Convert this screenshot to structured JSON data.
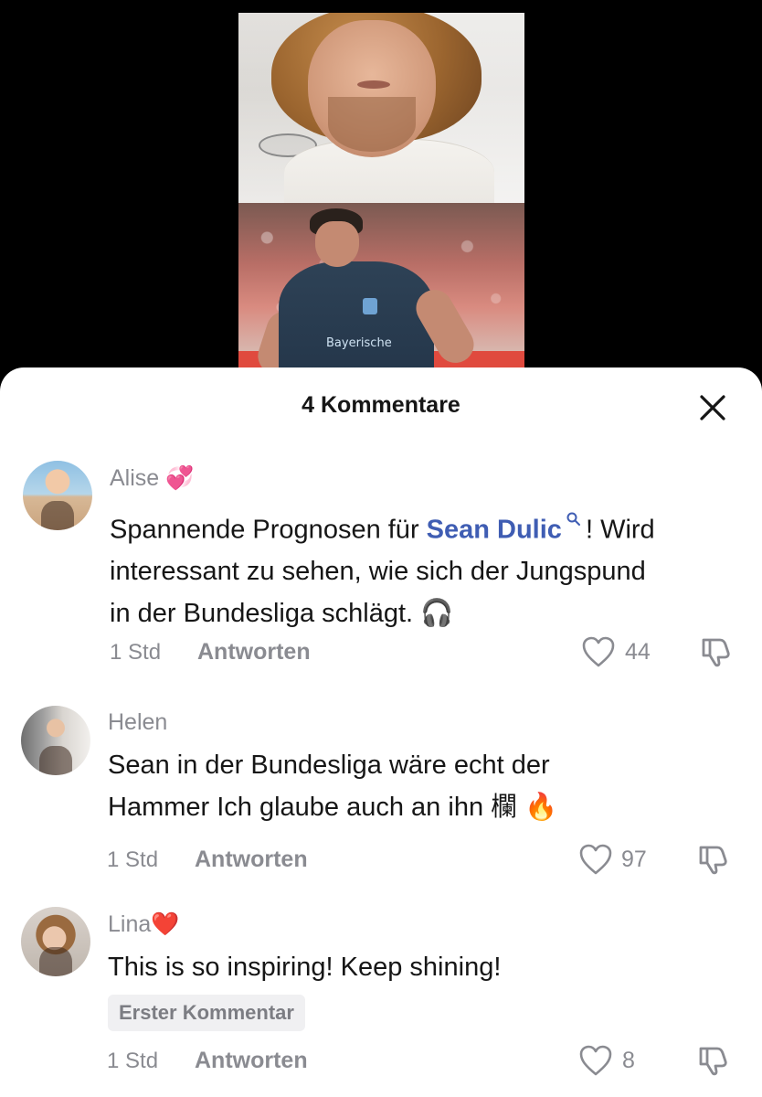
{
  "video": {
    "top_frame": "creator-webcam",
    "bottom_frame": "football-player-photo",
    "jersey_text": "Bayerische"
  },
  "sheet": {
    "title": "4 Kommentare",
    "close_icon": "close-icon"
  },
  "comments": [
    {
      "username": "Alise",
      "username_emoji": "💞",
      "text_before": "Spannende Prognosen für ",
      "mention": "Sean Dulic",
      "mention_icon": "search-icon",
      "text_after_line1": "! Wird",
      "text_line2": "interessant zu sehen, wie sich der Jungspund",
      "text_line3": "in der Bundesliga schlägt.",
      "text_emoji": "🎧",
      "time": "1 Std",
      "reply_label": "Antworten",
      "likes": "44"
    },
    {
      "username": "Helen",
      "text_line1": "Sean in der Bundesliga wäre echt der",
      "text_line2": "Hammer Ich glaube auch an ihn 欄",
      "text_emoji": "🔥",
      "time": "1 Std",
      "reply_label": "Antworten",
      "likes": "97"
    },
    {
      "username": "Lina",
      "username_emoji": "❤️",
      "text_line1": "This is so inspiring! Keep shining!",
      "tag": "Erster Kommentar",
      "time": "1 Std",
      "reply_label": "Antworten",
      "likes": "8"
    }
  ],
  "colors": {
    "mention": "#3f5db3",
    "muted": "#8a8b91",
    "text": "#161616",
    "background": "#ffffff"
  }
}
